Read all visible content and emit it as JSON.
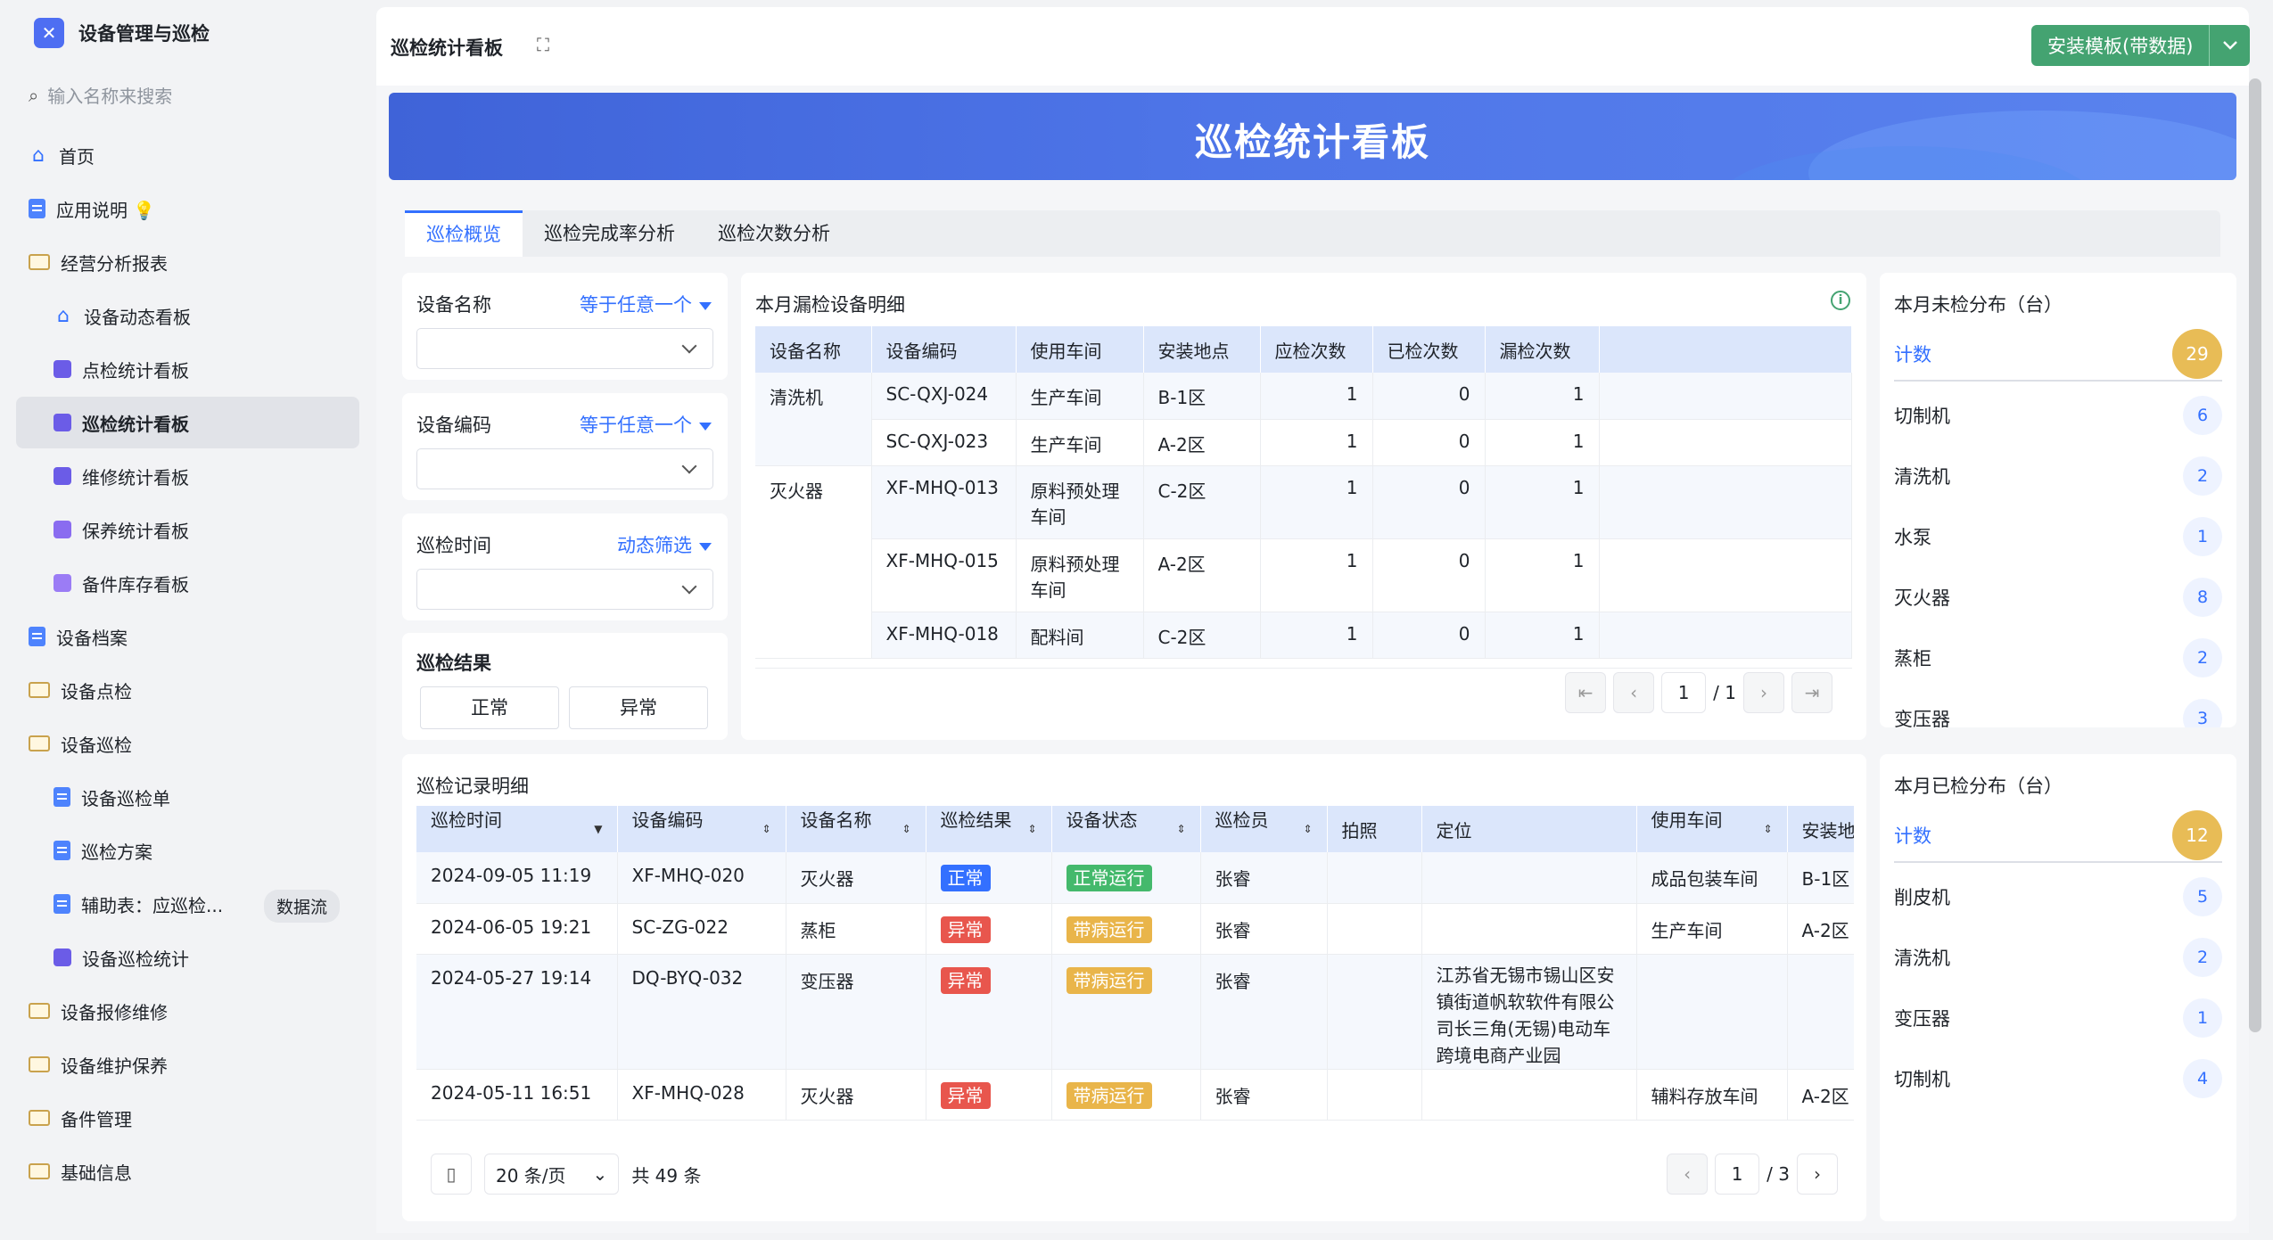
{
  "app": {
    "title": "设备管理与巡检",
    "search_placeholder": "输入名称来搜索"
  },
  "nav": [
    {
      "label": "首页",
      "level": 1,
      "icon": "home-icon"
    },
    {
      "label": "应用说明 💡",
      "level": 1,
      "icon": "doc-icon"
    },
    {
      "label": "经营分析报表",
      "level": 1,
      "icon": "folder-icon"
    },
    {
      "label": "设备动态看板",
      "level": 2,
      "icon": "home-icon"
    },
    {
      "label": "点检统计看板",
      "level": 2,
      "icon": "chart-icon"
    },
    {
      "label": "巡检统计看板",
      "level": 2,
      "icon": "dashboard-icon",
      "active": true
    },
    {
      "label": "维修统计看板",
      "level": 2,
      "icon": "shield-icon"
    },
    {
      "label": "保养统计看板",
      "level": 2,
      "icon": "calendar-icon"
    },
    {
      "label": "备件库存看板",
      "level": 2,
      "icon": "box-icon"
    },
    {
      "label": "设备档案",
      "level": 1,
      "icon": "doc-icon"
    },
    {
      "label": "设备点检",
      "level": 1,
      "icon": "folder-icon"
    },
    {
      "label": "设备巡检",
      "level": 1,
      "icon": "folder-icon"
    },
    {
      "label": "设备巡检单",
      "level": 2,
      "icon": "doc-icon"
    },
    {
      "label": "巡检方案",
      "level": 2,
      "icon": "doc-icon"
    },
    {
      "label": "辅助表：应巡检...",
      "level": 2,
      "icon": "doc-icon",
      "badge": "数据流"
    },
    {
      "label": "设备巡检统计",
      "level": 2,
      "icon": "dashboard-icon"
    },
    {
      "label": "设备报修维修",
      "level": 1,
      "icon": "folder-icon"
    },
    {
      "label": "设备维护保养",
      "level": 1,
      "icon": "folder-icon"
    },
    {
      "label": "备件管理",
      "level": 1,
      "icon": "folder-icon"
    },
    {
      "label": "基础信息",
      "level": 1,
      "icon": "folder-icon"
    }
  ],
  "header": {
    "page_title": "巡检统计看板",
    "install_button": "安装模板(带数据)"
  },
  "banner": {
    "title": "巡检统计看板"
  },
  "tabs": [
    "巡检概览",
    "巡检完成率分析",
    "巡检次数分析"
  ],
  "filters": {
    "device_name": {
      "label": "设备名称",
      "op": "等于任意一个"
    },
    "device_code": {
      "label": "设备编码",
      "op": "等于任意一个"
    },
    "patrol_time": {
      "label": "巡检时间",
      "op": "动态筛选"
    },
    "result": {
      "label": "巡检结果",
      "options": [
        "正常",
        "异常"
      ]
    }
  },
  "missed": {
    "title": "本月漏检设备明细",
    "columns": [
      "设备名称",
      "设备编码",
      "使用车间",
      "安装地点",
      "应检次数",
      "已检次数",
      "漏检次数"
    ],
    "rows": [
      {
        "name": "清洗机",
        "code": "SC-QXJ-024",
        "workshop": "生产车间",
        "location": "B-1区",
        "should": "1",
        "done": "0",
        "missed": "1"
      },
      {
        "name": "",
        "code": "SC-QXJ-023",
        "workshop": "生产车间",
        "location": "A-2区",
        "should": "1",
        "done": "0",
        "missed": "1"
      },
      {
        "name": "灭火器",
        "code": "XF-MHQ-013",
        "workshop": "原料预处理车间",
        "location": "C-2区",
        "should": "1",
        "done": "0",
        "missed": "1"
      },
      {
        "name": "",
        "code": "XF-MHQ-015",
        "workshop": "原料预处理车间",
        "location": "A-2区",
        "should": "1",
        "done": "0",
        "missed": "1"
      },
      {
        "name": "",
        "code": "XF-MHQ-018",
        "workshop": "配料间",
        "location": "C-2区",
        "should": "1",
        "done": "0",
        "missed": "1"
      }
    ],
    "page": "1",
    "total_pages": "/ 1"
  },
  "unchecked": {
    "title": "本月未检分布（台）",
    "head": {
      "label": "计数",
      "value": "29"
    },
    "items": [
      {
        "label": "切制机",
        "value": "6"
      },
      {
        "label": "清洗机",
        "value": "2"
      },
      {
        "label": "水泵",
        "value": "1"
      },
      {
        "label": "灭火器",
        "value": "8"
      },
      {
        "label": "蒸柜",
        "value": "2"
      },
      {
        "label": "变压器",
        "value": "3"
      }
    ]
  },
  "checked": {
    "title": "本月已检分布（台）",
    "head": {
      "label": "计数",
      "value": "12"
    },
    "items": [
      {
        "label": "削皮机",
        "value": "5"
      },
      {
        "label": "清洗机",
        "value": "2"
      },
      {
        "label": "变压器",
        "value": "1"
      },
      {
        "label": "切制机",
        "value": "4"
      }
    ]
  },
  "records": {
    "title": "巡检记录明细",
    "columns": [
      "巡检时间",
      "设备编码",
      "设备名称",
      "巡检结果",
      "设备状态",
      "巡检员",
      "拍照",
      "定位",
      "使用车间",
      "安装地"
    ],
    "rows": [
      {
        "time": "2024-09-05 11:19",
        "code": "XF-MHQ-020",
        "name": "灭火器",
        "result": "正常",
        "result_color": "blue",
        "status": "正常运行",
        "status_color": "green",
        "inspector": "张睿",
        "location": "",
        "workshop": "成品包装车间",
        "site": "B-1区"
      },
      {
        "time": "2024-06-05 19:21",
        "code": "SC-ZG-022",
        "name": "蒸柜",
        "result": "异常",
        "result_color": "red",
        "status": "带病运行",
        "status_color": "gold",
        "inspector": "张睿",
        "location": "",
        "workshop": "生产车间",
        "site": "A-2区"
      },
      {
        "time": "2024-05-27 19:14",
        "code": "DQ-BYQ-032",
        "name": "变压器",
        "result": "异常",
        "result_color": "red",
        "status": "带病运行",
        "status_color": "gold",
        "inspector": "张睿",
        "location": "江苏省无锡市锡山区安镇街道帆软软件有限公司长三角(无锡)电动车跨境电商产业园",
        "workshop": "",
        "site": ""
      },
      {
        "time": "2024-05-11 16:51",
        "code": "XF-MHQ-028",
        "name": "灭火器",
        "result": "异常",
        "result_color": "red",
        "status": "带病运行",
        "status_color": "gold",
        "inspector": "张睿",
        "location": "",
        "workshop": "辅料存放车间",
        "site": "A-2区"
      }
    ],
    "page_size": "20 条/页",
    "total": "共 49 条",
    "page": "1",
    "total_pages": "/ 3"
  }
}
